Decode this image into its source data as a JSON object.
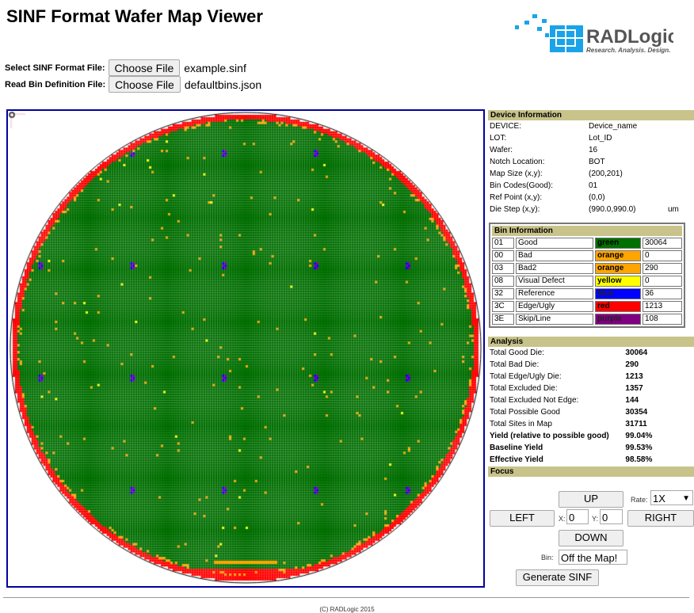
{
  "title": "SINF Format Wafer Map Viewer",
  "logo": {
    "name": "RADLogic",
    "tagline": "Research. Analysis. Design."
  },
  "files": [
    {
      "label": "Select SINF Format File:",
      "button": "Choose File",
      "filename": "example.sinf"
    },
    {
      "label": "Read Bin Definition File:",
      "button": "Choose File",
      "filename": "defaultbins.json"
    }
  ],
  "device": {
    "header": "Device Information",
    "rows": [
      {
        "k": "DEVICE:",
        "v": "Device_name"
      },
      {
        "k": "LOT:",
        "v": "Lot_ID"
      },
      {
        "k": "Wafer:",
        "v": "16"
      },
      {
        "k": "Notch Location:",
        "v": "BOT"
      },
      {
        "k": "Map Size (x,y):",
        "v": "(200,201)"
      },
      {
        "k": "Bin Codes(Good):",
        "v": "01"
      },
      {
        "k": "Ref Point (x,y):",
        "v": "(0,0)"
      },
      {
        "k": "Die Step (x,y):",
        "v": "(990.0,990.0)",
        "unit": "um"
      }
    ]
  },
  "bins": {
    "header": "Bin Information",
    "rows": [
      {
        "code": "01",
        "name": "Good",
        "color": "green",
        "hex": "#007000",
        "count": "30064"
      },
      {
        "code": "00",
        "name": "Bad",
        "color": "orange",
        "hex": "#ffa500",
        "count": "0"
      },
      {
        "code": "03",
        "name": "Bad2",
        "color": "orange",
        "hex": "#ffa500",
        "count": "290"
      },
      {
        "code": "08",
        "name": "Visual Defect",
        "color": "yellow",
        "hex": "#ffff00",
        "count": "0"
      },
      {
        "code": "32",
        "name": "Reference",
        "color": "blue",
        "hex": "#0000ff",
        "count": "36"
      },
      {
        "code": "3C",
        "name": "Edge/Ugly",
        "color": "red",
        "hex": "#ff0000",
        "count": "1213"
      },
      {
        "code": "3E",
        "name": "Skip/Line",
        "color": "purple",
        "hex": "#800080",
        "count": "108"
      }
    ]
  },
  "analysis": {
    "header": "Analysis",
    "rows": [
      {
        "k": "Total Good Die:",
        "v": "30064",
        "bold": false
      },
      {
        "k": "Total Bad Die:",
        "v": "290",
        "bold": false
      },
      {
        "k": "Total Edge/Ugly Die:",
        "v": "1213",
        "bold": false
      },
      {
        "k": "Total Excluded Die:",
        "v": "1357",
        "bold": false
      },
      {
        "k": "Total Excluded Not Edge:",
        "v": "144",
        "bold": false
      },
      {
        "k": "Total Possible Good",
        "v": "30354",
        "bold": false
      },
      {
        "k": "Total Sites in Map",
        "v": "31711",
        "bold": false
      },
      {
        "k": "Yield (relative to possible good)",
        "v": "99.04%",
        "bold": true
      },
      {
        "k": "Baseline Yield",
        "v": "99.53%",
        "bold": true
      },
      {
        "k": "Effective Yield",
        "v": "98.58%",
        "bold": true
      }
    ]
  },
  "focus": {
    "header": "Focus",
    "up": "UP",
    "down": "DOWN",
    "left": "LEFT",
    "right": "RIGHT",
    "rate_label": "Rate:",
    "rate": "1X",
    "x_label": "X:",
    "x": "0",
    "y_label": "Y:",
    "y": "0",
    "bin_label": "Bin:",
    "bin": "Off the Map!",
    "generate": "Generate SINF"
  },
  "map": {
    "cols": 200,
    "rows": 201,
    "notch": "BOT"
  },
  "footer": "(C) RADLogic 2015"
}
